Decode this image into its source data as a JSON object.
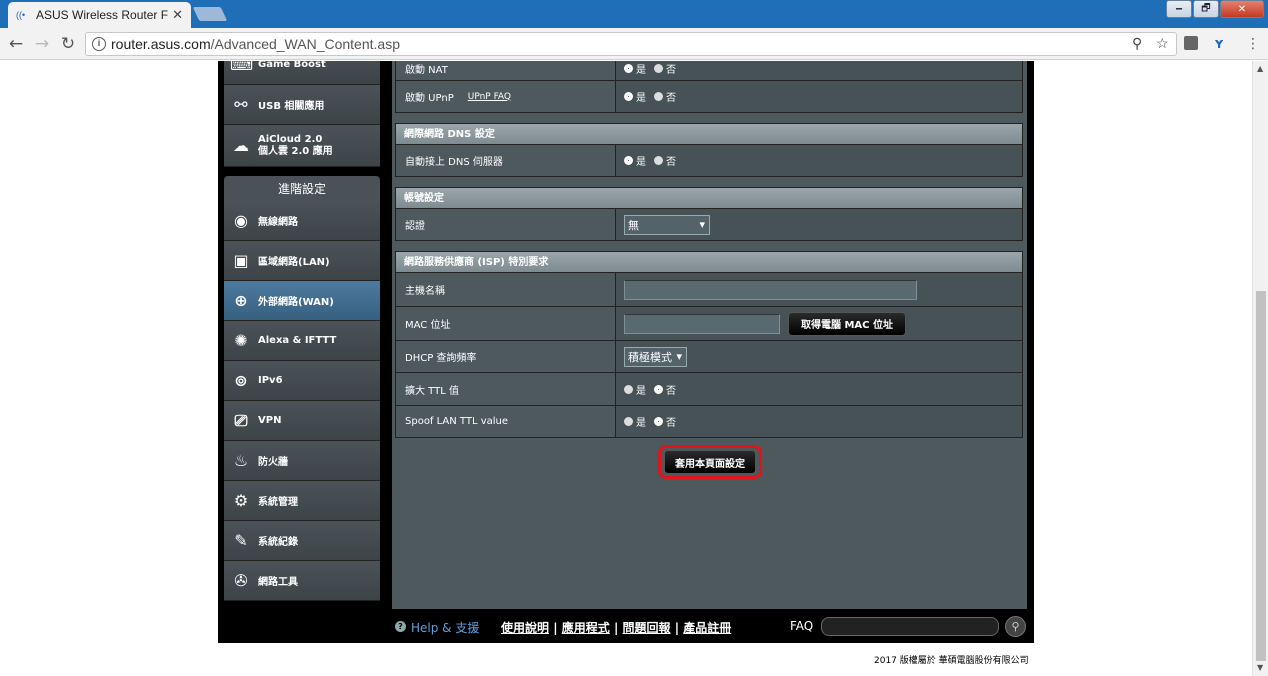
{
  "browser": {
    "tab_title": "ASUS Wireless Router F",
    "tab_close": "✕",
    "url_host": "router.asus.com",
    "url_path": "/Advanced_WAN_Content.asp",
    "window_buttons": [
      "🗕",
      "🗗",
      "✕"
    ]
  },
  "sidebar": {
    "top_items": [
      {
        "label": "Game Boost",
        "icon": "gamepad-icon"
      },
      {
        "label": "USB 相關應用",
        "icon": "usb-icon"
      },
      {
        "label": "AiCloud 2.0\n個人雲 2.0 應用",
        "line1": "AiCloud 2.0",
        "line2": "個人雲 2.0 應用",
        "icon": "cloud-icon"
      }
    ],
    "section_title": "進階設定",
    "items": [
      {
        "label": "無線網路",
        "icon": "wifi-icon"
      },
      {
        "label": "區域網路(LAN)",
        "icon": "lan-icon"
      },
      {
        "label": "外部網路(WAN)",
        "icon": "globe-icon",
        "active": true
      },
      {
        "label": "Alexa & IFTTT",
        "icon": "alexa-icon"
      },
      {
        "label": "IPv6",
        "icon": "ipv6-icon"
      },
      {
        "label": "VPN",
        "icon": "vpn-icon"
      },
      {
        "label": "防火牆",
        "icon": "firewall-icon"
      },
      {
        "label": "系統管理",
        "icon": "admin-icon"
      },
      {
        "label": "系統紀錄",
        "icon": "log-icon"
      },
      {
        "label": "網路工具",
        "icon": "tools-icon"
      }
    ]
  },
  "form": {
    "nat_label": "啟動 NAT",
    "upnp_label": "啟動 UPnP",
    "upnp_faq": "UPnP FAQ",
    "yes": "是",
    "no": "否",
    "dns_section": "網際網路 DNS 設定",
    "dns_auto_label": "自動接上 DNS 伺服器",
    "account_section": "帳號設定",
    "auth_label": "認證",
    "auth_value": "無",
    "isp_section": "網路服務供應商 (ISP) 特別要求",
    "hostname_label": "主機名稱",
    "mac_label": "MAC 位址",
    "mac_clone_button": "取得電腦 MAC 位址",
    "dhcp_label": "DHCP 查詢頻率",
    "dhcp_value": "積極模式",
    "ttl_label": "擴大 TTL 值",
    "spoof_label": "Spoof LAN TTL value",
    "apply_button": "套用本頁面設定"
  },
  "footer": {
    "help": "Help & 支援",
    "links": [
      "使用說明",
      "應用程式",
      "問題回報",
      "產品註冊"
    ],
    "faq": "FAQ",
    "copyright": "2017 版權屬於 華碩電腦股份有限公司"
  },
  "colors": {
    "accent_red": "#e0141c",
    "panel": "#4d595d",
    "help_blue": "#5fa0e0"
  }
}
